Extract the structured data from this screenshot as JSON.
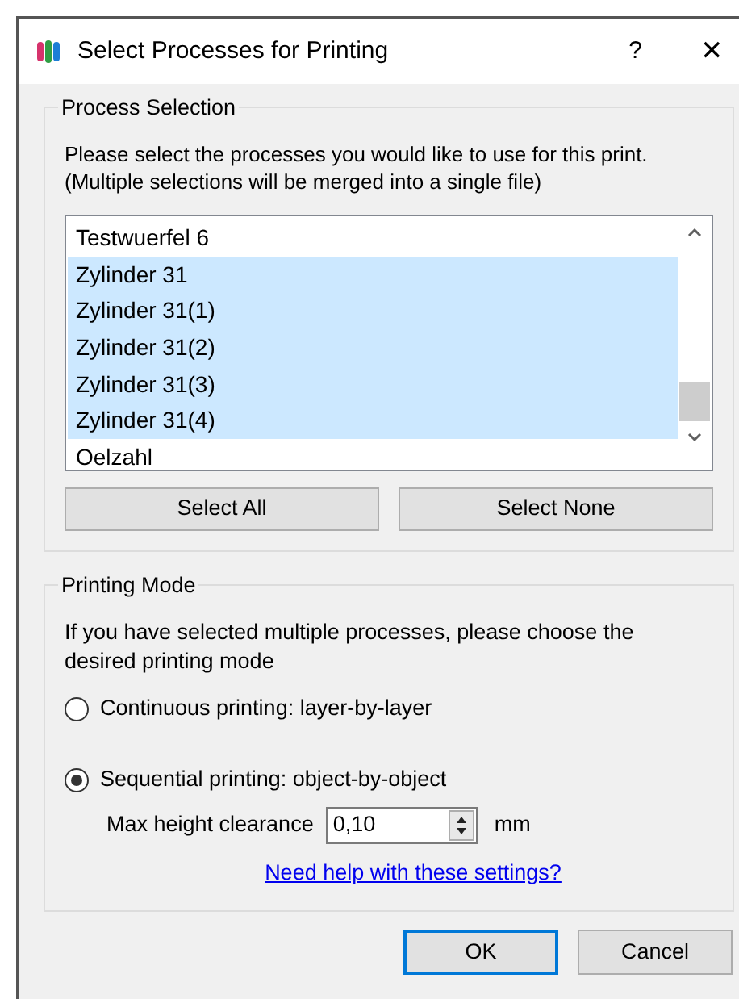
{
  "window": {
    "title": "Select Processes for Printing",
    "help": "?",
    "close": "✕"
  },
  "process_selection": {
    "title": "Process Selection",
    "description": "Please select the processes you would like to use for this print.\n(Multiple selections will be merged into a single file)",
    "items": [
      {
        "label": "Testwuerfel 6",
        "selected": false
      },
      {
        "label": "Zylinder 31",
        "selected": true
      },
      {
        "label": "Zylinder 31(1)",
        "selected": true
      },
      {
        "label": "Zylinder 31(2)",
        "selected": true
      },
      {
        "label": "Zylinder 31(3)",
        "selected": true
      },
      {
        "label": "Zylinder 31(4)",
        "selected": true
      },
      {
        "label": "Oelzahl",
        "selected": false
      }
    ],
    "buttons": [
      "Select All",
      "Select None"
    ]
  },
  "printing_mode": {
    "title": "Printing Mode",
    "description": "If you have selected multiple processes, please choose the desired printing mode",
    "options": [
      {
        "label": "Continuous printing: layer-by-layer",
        "selected": false
      },
      {
        "label": "Sequential printing: object-by-object",
        "selected": true
      }
    ],
    "clearance": {
      "label": "Max height clearance",
      "value": "0,10",
      "unit": "mm"
    },
    "help_link": "Need help with these settings?"
  },
  "buttons": [
    {
      "label": "OK",
      "default": true
    },
    {
      "label": "Cancel",
      "default": false
    }
  ]
}
